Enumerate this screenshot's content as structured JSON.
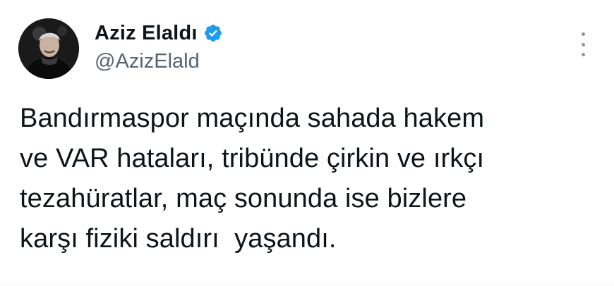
{
  "tweet": {
    "author": {
      "display_name": "Aziz Elaldı",
      "handle": "@AzizElald",
      "verified": true
    },
    "text": "Bandırmaspor maçında sahada hakem\nve VAR hataları, tribünde çirkin ve ırkçı\ntezahüratlar, maç sonunda ise bizlere\nkarşı fiziki saldırı  yaşandı."
  },
  "colors": {
    "verified_badge": "#1d9bf0",
    "text_primary": "#0f1419",
    "text_secondary": "#536471"
  },
  "icons": {
    "verified": "verified-badge-icon",
    "more": "more-vertical-icon"
  }
}
